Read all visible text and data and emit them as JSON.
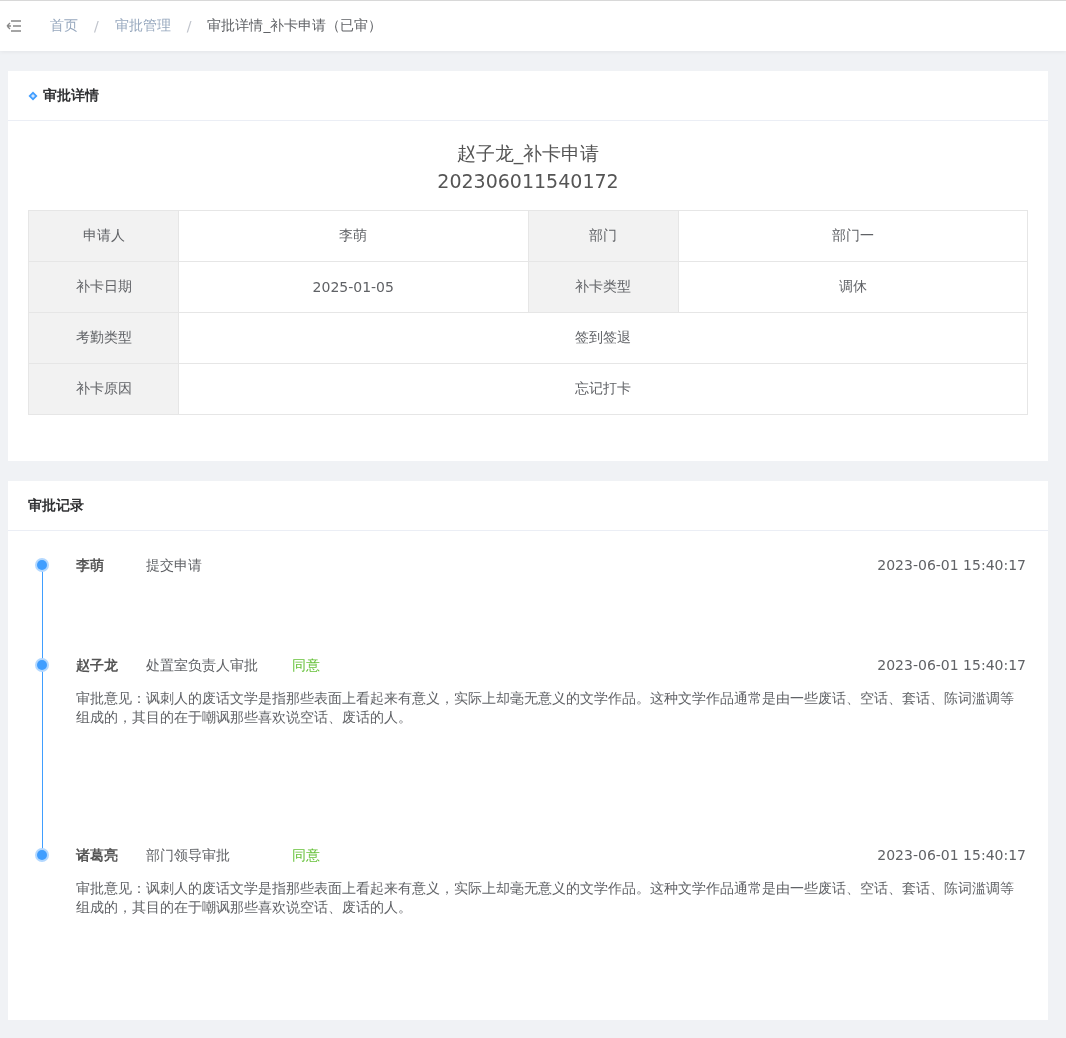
{
  "breadcrumb": [
    {
      "label": "首页",
      "current": false
    },
    {
      "separator": "/",
      "label": "审批管理",
      "current": false
    },
    {
      "separator": "/",
      "label": "审批详情_补卡申请（已审）",
      "current": true
    }
  ],
  "detail": {
    "heading": "审批详情",
    "title": "赵子龙_补卡申请",
    "number": "202306011540172",
    "rows": [
      {
        "cells": [
          {
            "label": "申请人",
            "value": "李萌"
          },
          {
            "label": "部门",
            "value": "部门一"
          }
        ]
      },
      {
        "cells": [
          {
            "label": "补卡日期",
            "value": "2025-01-05"
          },
          {
            "label": "补卡类型",
            "value": "调休"
          }
        ]
      },
      {
        "cells": [
          {
            "label": "考勤类型",
            "value": "签到签退"
          }
        ]
      },
      {
        "cells": [
          {
            "label": "补卡原因",
            "value": "忘记打卡"
          }
        ]
      }
    ]
  },
  "records": {
    "heading": "审批记录",
    "items": [
      {
        "name": "李萌",
        "action": "提交申请",
        "time": "2023-06-01 15:40:17"
      },
      {
        "name": "赵子龙",
        "action": "处置室负责人审批",
        "result": "同意",
        "color": "#67c23a",
        "time": "2023-06-01 15:40:17",
        "comment": "审批意见：讽刺人的废话文学是指那些表面上看起来有意义，实际上却毫无意义的文学作品。这种文学作品通常是由一些废话、空话、套话、陈词滥调等组成的，其目的在于嘲讽那些喜欢说空话、废话的人。"
      },
      {
        "name": "诸葛亮",
        "action": "部门领导审批",
        "result": "同意",
        "color": "#67c23a",
        "time": "2023-06-01 15:40:17",
        "comment": "审批意见：讽刺人的废话文学是指那些表面上看起来有意义，实际上却毫无意义的文学作品。这种文学作品通常是由一些废话、空话、套话、陈词滥调等组成的，其目的在于嘲讽那些喜欢说空话、废话的人。"
      }
    ]
  }
}
